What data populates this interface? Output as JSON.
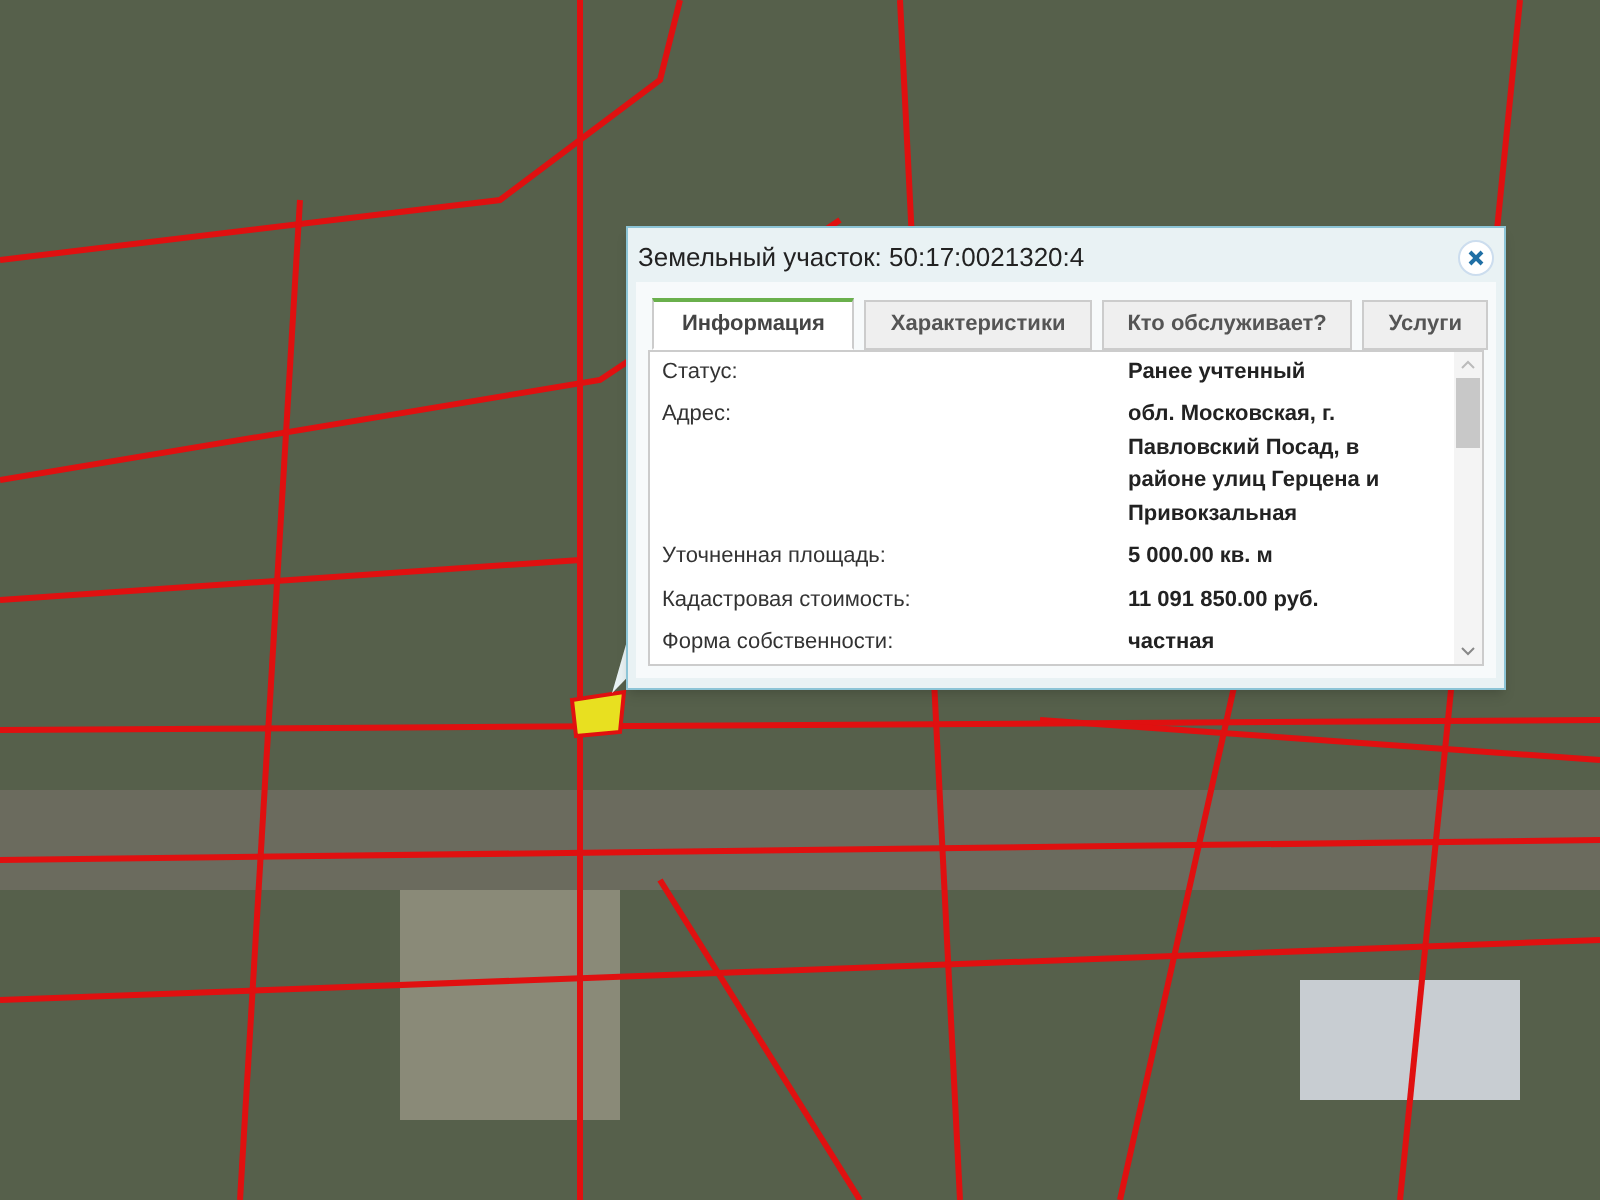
{
  "popup": {
    "title": "Земельный участок: 50:17:0021320:4",
    "tabs": [
      {
        "label": "Информация",
        "selected": true
      },
      {
        "label": "Характеристики",
        "selected": false
      },
      {
        "label": "Кто обслуживает?",
        "selected": false
      },
      {
        "label": "Услуги",
        "selected": false
      }
    ],
    "fields": [
      {
        "label": "Статус:",
        "value": "Ранее учтенный"
      },
      {
        "label": "Адрес:",
        "value": "обл. Московская, г. Павловский Посад, в районе улиц Герцена и Привокзальная"
      },
      {
        "label": "Уточненная площадь:",
        "value": "5 000.00 кв. м"
      },
      {
        "label": "Кадастровая стоимость:",
        "value": "11 091 850.00 руб."
      },
      {
        "label": "Форма собственности:",
        "value": "частная"
      }
    ]
  }
}
